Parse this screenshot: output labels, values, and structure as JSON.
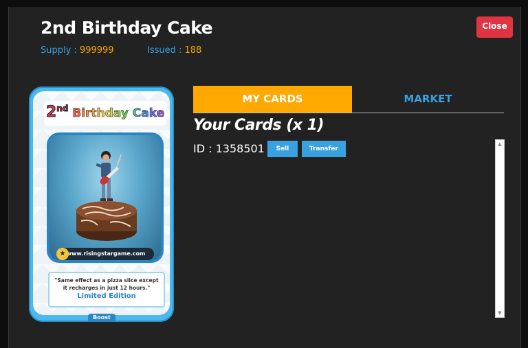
{
  "header": {
    "title": "2nd Birthday Cake",
    "supply_label": "Supply : ",
    "supply_value": "999999",
    "issued_label": "Issued : ",
    "issued_value": "188",
    "close_label": "Close"
  },
  "card": {
    "title_num": "2",
    "title_suffix": "nd",
    "title_name": "Birthday Cake",
    "website": "www.risingstargame.com",
    "quote": "\"Same effect as a pizza slice except it recharges in just 12 hours.\"",
    "edition": "Limited Edition",
    "boost_label": "Boost"
  },
  "tabs": [
    {
      "label": "MY CARDS",
      "active": true
    },
    {
      "label": "MARKET",
      "active": false
    }
  ],
  "your_cards": {
    "heading": "Your Cards (x 1)",
    "items": [
      {
        "id_text": "ID : 1358501",
        "sell_label": "Sell",
        "transfer_label": "Transfer"
      }
    ]
  },
  "colors": {
    "accent_orange": "#ffa800",
    "accent_blue": "#3aa1e0",
    "close_red": "#e03443",
    "background": "#222222"
  }
}
